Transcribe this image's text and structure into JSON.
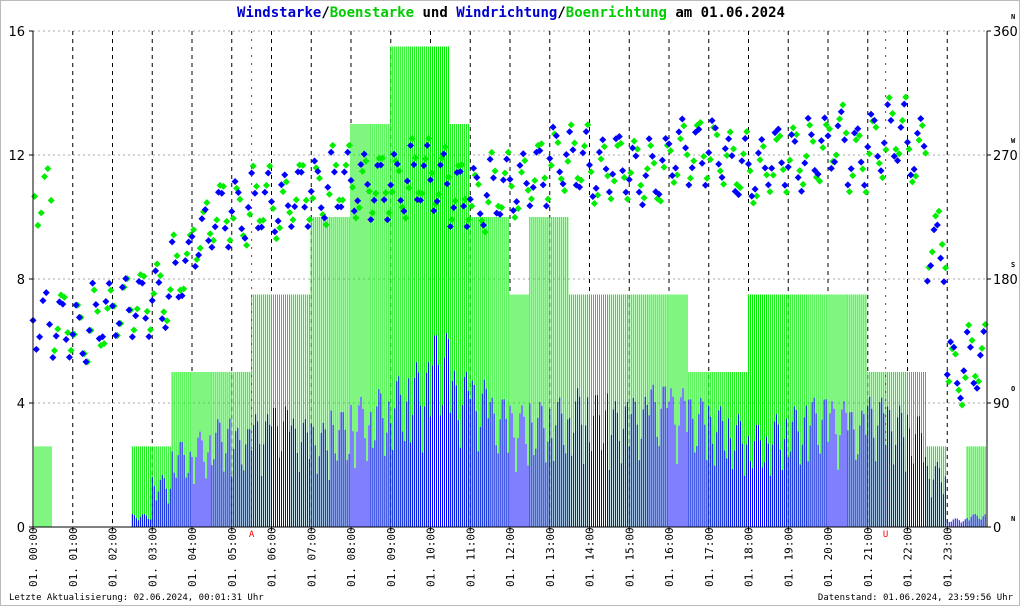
{
  "title": {
    "part1": "Windstarke",
    "sep1": "/",
    "part2": "Boenstarke",
    "part3": " und ",
    "part4": "Windrichtung",
    "sep2": "/",
    "part5": "Boenrichtung",
    "part6": " am 01.06.2024"
  },
  "footer": {
    "left": "Letzte Aktualisierung: 02.06.2024, 00:01:31 Uhr",
    "right": "Datenstand: 01.06.2024, 23:59:56 Uhr"
  },
  "colors": {
    "wind": "#0000ff",
    "gust": "#00ee00",
    "title_blue": "#0000cc",
    "title_green": "#00cc00",
    "sun": "#ff0000"
  },
  "chart_data": {
    "type": "bar",
    "title": "Windstarke/Boenstarke und Windrichtung/Boenrichtung am 01.06.2024",
    "x_unit": "hour",
    "x": [
      0,
      0.5,
      1,
      1.5,
      2,
      2.5,
      3,
      3.5,
      4,
      4.5,
      5,
      5.5,
      6,
      6.5,
      7,
      7.5,
      8,
      8.5,
      9,
      9.5,
      10,
      10.5,
      11,
      11.5,
      12,
      12.5,
      13,
      13.5,
      14,
      14.5,
      15,
      15.5,
      16,
      16.5,
      17,
      17.5,
      18,
      18.5,
      19,
      19.5,
      20,
      20.5,
      21,
      21.5,
      22,
      22.5,
      23,
      23.5
    ],
    "xlim": [
      0,
      24
    ],
    "x_tick_labels": [
      "01. 00:00",
      "01. 01:00",
      "01. 02:00",
      "01. 03:00",
      "01. 04:00",
      "01. 05:00",
      "01. 06:00",
      "01. 07:00",
      "01. 08:00",
      "01. 09:00",
      "01. 10:00",
      "01. 11:00",
      "01. 12:00",
      "01. 13:00",
      "01. 14:00",
      "01. 15:00",
      "01. 16:00",
      "01. 17:00",
      "01. 18:00",
      "01. 19:00",
      "01. 20:00",
      "01. 21:00",
      "01. 22:00",
      "01. 23:00"
    ],
    "y_left": {
      "ylim": [
        0,
        16
      ],
      "ticks": [
        "0",
        "4",
        "8",
        "12",
        "16"
      ]
    },
    "y_right": {
      "ylim": [
        0,
        360
      ],
      "ticks": [
        "0",
        "90",
        "180",
        "270",
        "360"
      ],
      "compass": [
        "N",
        "O",
        "S",
        "W",
        "N"
      ]
    },
    "series": [
      {
        "name": "Windstarke",
        "kind": "bar",
        "axis": "left",
        "values": [
          0,
          0,
          0,
          0,
          0,
          0.3,
          1.2,
          2,
          2.2,
          2.5,
          2.3,
          2.6,
          2.8,
          2.5,
          2.4,
          2.7,
          3,
          3.2,
          3.5,
          3.8,
          4.5,
          3.6,
          3.4,
          3,
          2.8,
          2.9,
          3,
          3.2,
          3.1,
          2.9,
          3,
          3.3,
          3.2,
          3,
          2.8,
          2.6,
          2.4,
          2.6,
          2.8,
          3,
          2.9,
          2.7,
          3,
          2.8,
          2.6,
          1.5,
          0.2,
          0.3
        ]
      },
      {
        "name": "Boenstarke",
        "kind": "bar",
        "axis": "left",
        "values": [
          2.6,
          0,
          0,
          0,
          0,
          2.6,
          2.6,
          5,
          5,
          5,
          5,
          7.5,
          7.5,
          7.5,
          10,
          10,
          13,
          13,
          15.5,
          15.5,
          15.5,
          13,
          10,
          10,
          7.5,
          10,
          10,
          7.5,
          7.5,
          7.5,
          7.5,
          7.5,
          7.5,
          5,
          5,
          5,
          7.5,
          7.5,
          7.5,
          7.5,
          7.5,
          7.5,
          5,
          5,
          5,
          2.6,
          0,
          2.6
        ]
      },
      {
        "name": "Windrichtung",
        "kind": "scatter",
        "axis": "right",
        "values": [
          150,
          145,
          140,
          155,
          160,
          160,
          165,
          185,
          210,
          225,
          230,
          235,
          235,
          240,
          245,
          250,
          250,
          245,
          250,
          255,
          250,
          240,
          240,
          245,
          250,
          255,
          270,
          265,
          260,
          265,
          255,
          260,
          275,
          270,
          275,
          260,
          260,
          270,
          265,
          275,
          280,
          270,
          280,
          285,
          275,
          200,
          115,
          120
        ]
      },
      {
        "name": "Boenrichtung",
        "kind": "scatter",
        "axis": "right",
        "values": [
          240,
          150,
          140,
          150,
          160,
          165,
          170,
          190,
          215,
          230,
          225,
          240,
          230,
          245,
          240,
          255,
          245,
          250,
          245,
          260,
          255,
          245,
          235,
          250,
          245,
          260,
          265,
          270,
          255,
          260,
          260,
          255,
          270,
          275,
          270,
          265,
          255,
          265,
          270,
          270,
          285,
          265,
          275,
          290,
          270,
          210,
          110,
          125
        ]
      }
    ],
    "sun_markers": [
      {
        "label": "A",
        "hour": 5.5
      },
      {
        "label": "U",
        "hour": 21.45
      }
    ],
    "grid": true
  }
}
